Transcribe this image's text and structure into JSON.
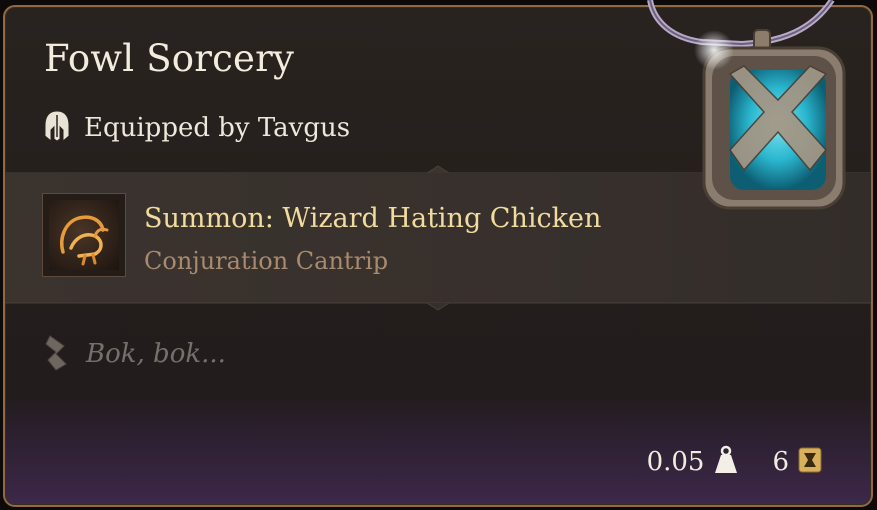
{
  "item": {
    "name": "Fowl Sorcery",
    "equipped_by": "Equipped by Tavgus"
  },
  "spell": {
    "name": "Summon: Wizard Hating Chicken",
    "school": "Conjuration Cantrip"
  },
  "flavor_text": "Bok, bok...",
  "footer": {
    "weight": "0.05",
    "value": "6"
  },
  "colors": {
    "border": "#8f6a45",
    "spell_name": "#f1dc9d",
    "spell_school": "#a88a6e",
    "gem": "#2ab6cf"
  },
  "icons": {
    "equipped": "helmet-icon",
    "spell": "chicken-rune-icon",
    "flavor": "scroll-quill-icon",
    "weight": "weight-icon",
    "value": "gold-coin-icon",
    "item": "amulet-icon"
  }
}
